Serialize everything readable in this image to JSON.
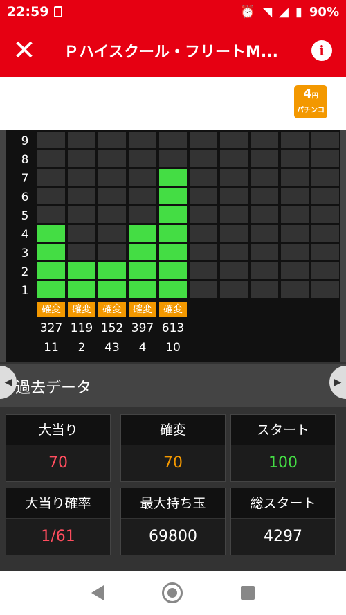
{
  "statusbar": {
    "time": "22:59",
    "battery": "90%"
  },
  "appbar": {
    "title": "Ｐハイスクール・フリートM...",
    "close_icon": "close-icon",
    "info_icon": "info-icon"
  },
  "badge": {
    "number": "4",
    "unit": "円",
    "text": "パチンコ"
  },
  "history": {
    "y_labels": [
      "9",
      "8",
      "7",
      "6",
      "5",
      "4",
      "3",
      "2",
      "1"
    ],
    "columns": [
      {
        "level": 4,
        "tag": "確変",
        "value1": "327",
        "value2": "11"
      },
      {
        "level": 2,
        "tag": "確変",
        "value1": "119",
        "value2": "2"
      },
      {
        "level": 2,
        "tag": "確変",
        "value1": "152",
        "value2": "43"
      },
      {
        "level": 4,
        "tag": "確変",
        "value1": "397",
        "value2": "4"
      },
      {
        "level": 7,
        "tag": "確変",
        "value1": "613",
        "value2": "10"
      },
      {
        "level": 0
      },
      {
        "level": 0
      },
      {
        "level": 0
      },
      {
        "level": 0
      },
      {
        "level": 0
      }
    ],
    "colors": {
      "on": "#44dd44",
      "off": "#333333",
      "tag": "#f39800"
    }
  },
  "past": {
    "label": "過去データ"
  },
  "stats": [
    {
      "label": "大当り",
      "value": "70",
      "color": "#ff4d5e"
    },
    {
      "label": "確変",
      "value": "70",
      "color": "#f39800"
    },
    {
      "label": "スタート",
      "value": "100",
      "color": "#44dd44"
    },
    {
      "label": "大当り確率",
      "value": "1/61",
      "color": "#ff4d5e"
    },
    {
      "label": "最大持ち玉",
      "value": "69800",
      "color": "#ffffff"
    },
    {
      "label": "総スタート",
      "value": "4297",
      "color": "#ffffff"
    }
  ]
}
